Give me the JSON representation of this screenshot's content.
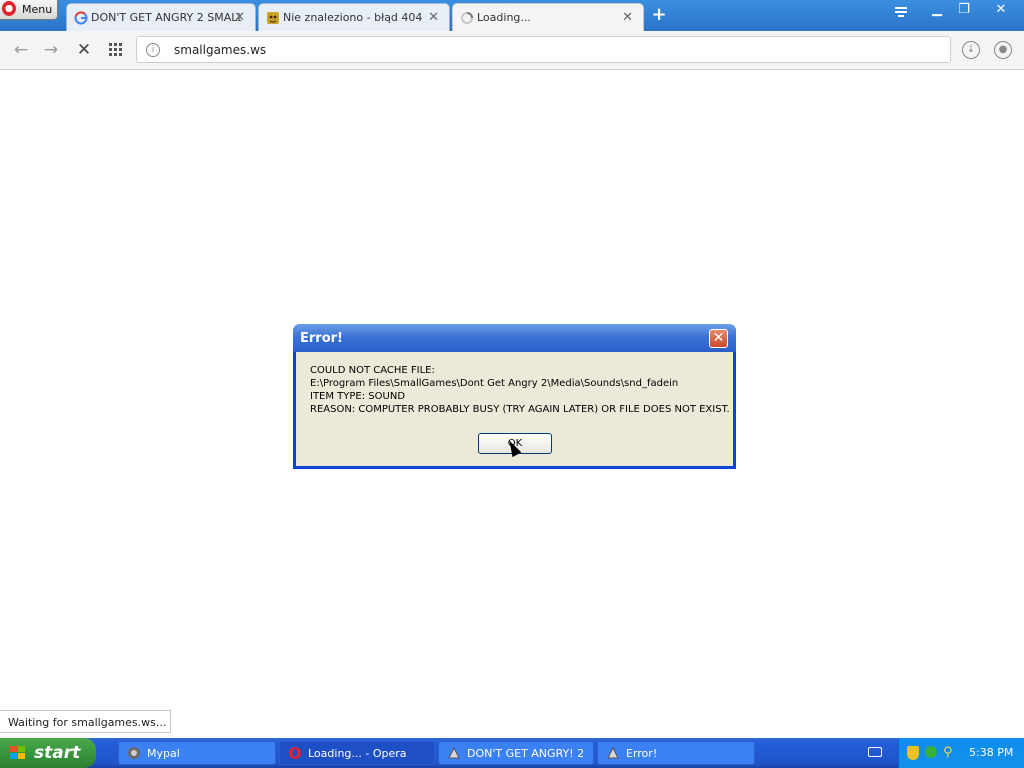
{
  "browser": {
    "menu_label": "Menu",
    "tabs": [
      {
        "title": "DON'T GET ANGRY 2 SMALL",
        "favicon": "google-icon"
      },
      {
        "title": "Nie znaleziono - błąd 404",
        "favicon": "mascot-icon"
      },
      {
        "title": "Loading...",
        "favicon": "loading-spinner-icon"
      }
    ],
    "address": "smallgames.ws",
    "status_text": "Waiting for smallgames.ws..."
  },
  "dialog": {
    "title": "Error!",
    "lines": [
      "COULD NOT CACHE FILE:",
      "E:\\Program Files\\SmallGames\\Dont Get Angry 2\\Media\\Sounds\\snd_fadein",
      "ITEM TYPE: SOUND",
      "REASON: COMPUTER PROBABLY BUSY (TRY AGAIN LATER) OR FILE DOES NOT EXIST."
    ],
    "ok_label": "OK"
  },
  "taskbar": {
    "start_label": "start",
    "tasks": [
      {
        "label": "Mypal"
      },
      {
        "label": "Loading... - Opera"
      },
      {
        "label": "DON'T GET ANGRY! 2"
      },
      {
        "label": "Error!"
      }
    ],
    "clock": "5:38 PM"
  },
  "colors": {
    "xp_title_blue": "#0a43d8",
    "dialog_face": "#ece9d8",
    "opera_red": "#e4222c",
    "taskbar_blue": "#245edb",
    "start_green": "#36913a"
  }
}
